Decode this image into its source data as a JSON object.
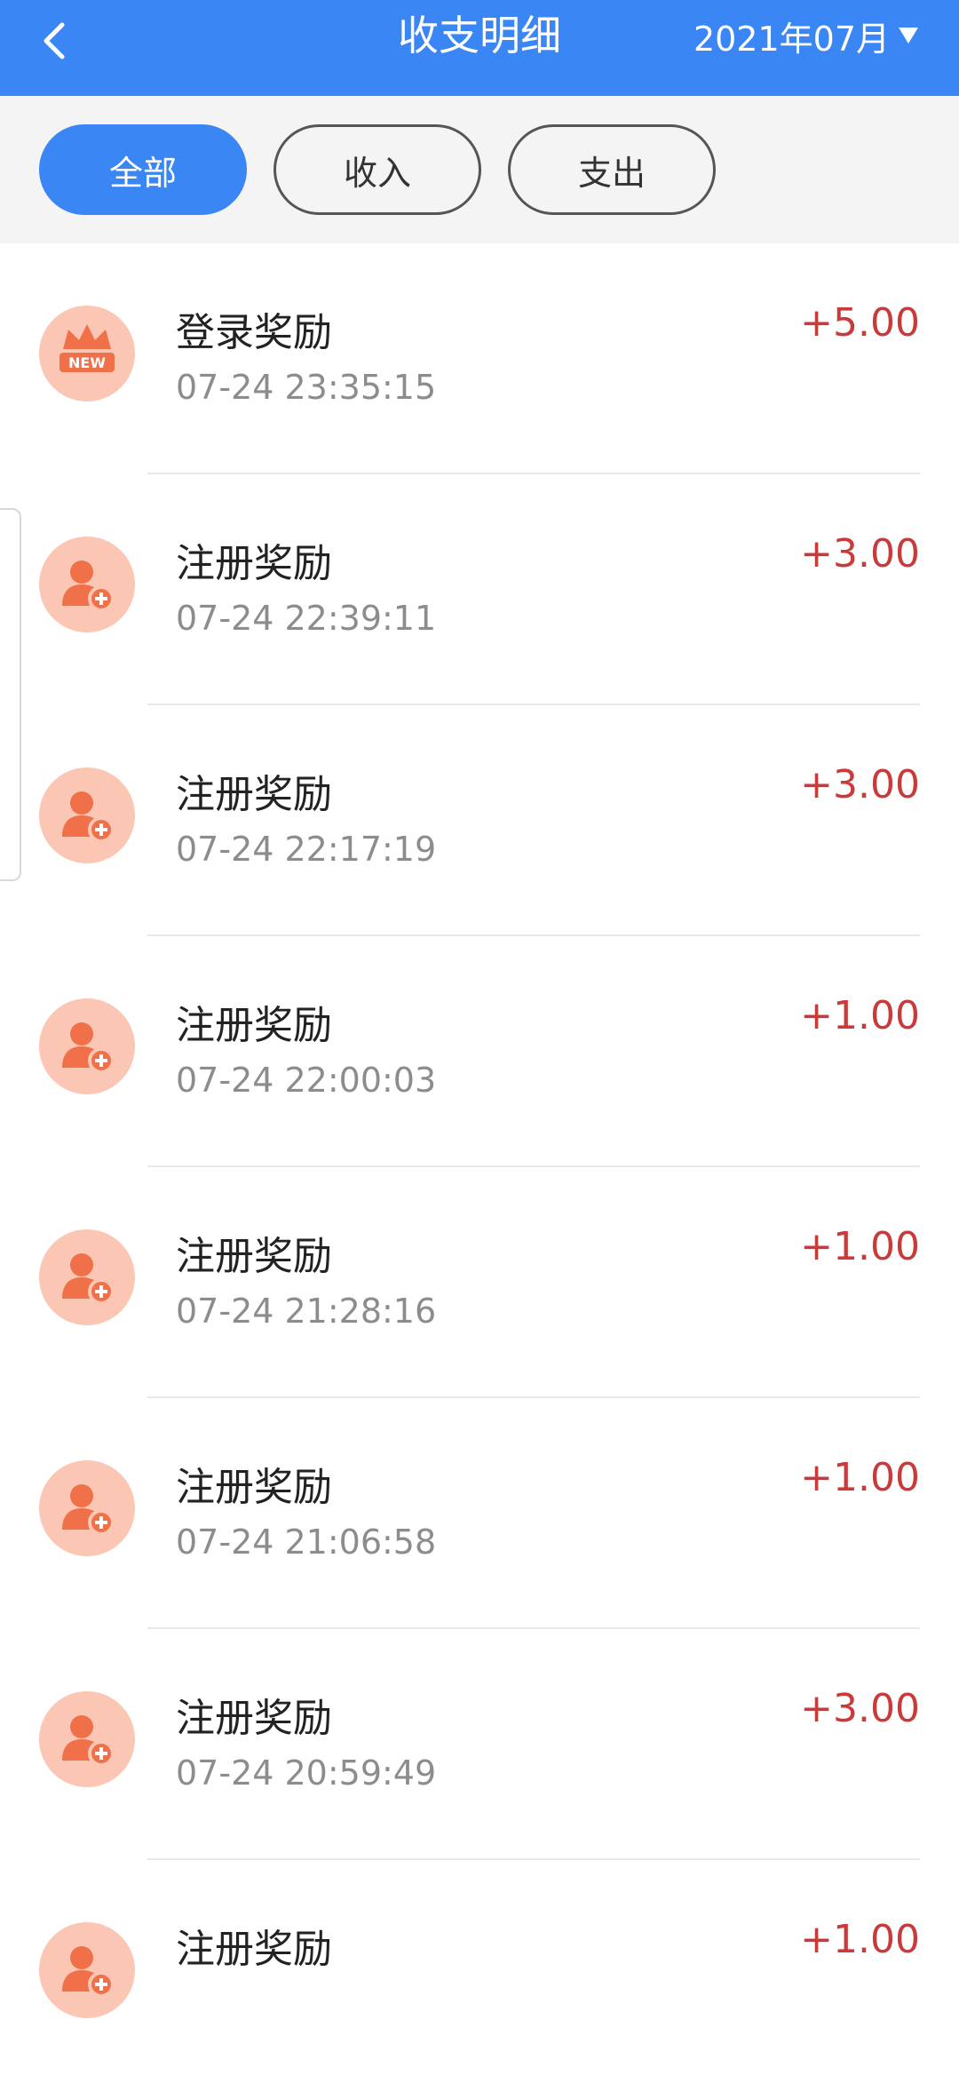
{
  "header": {
    "title": "收支明细",
    "month": "2021年07月"
  },
  "filters": [
    {
      "label": "全部",
      "active": true
    },
    {
      "label": "收入",
      "active": false
    },
    {
      "label": "支出",
      "active": false
    }
  ],
  "records": [
    {
      "title": "登录奖励",
      "time": "07-24 23:35:15",
      "amount": "+5.00",
      "icon": "crown-new-icon"
    },
    {
      "title": "注册奖励",
      "time": "07-24 22:39:11",
      "amount": "+3.00",
      "icon": "add-user-icon"
    },
    {
      "title": "注册奖励",
      "time": "07-24 22:17:19",
      "amount": "+3.00",
      "icon": "add-user-icon"
    },
    {
      "title": "注册奖励",
      "time": "07-24 22:00:03",
      "amount": "+1.00",
      "icon": "add-user-icon"
    },
    {
      "title": "注册奖励",
      "time": "07-24 21:28:16",
      "amount": "+1.00",
      "icon": "add-user-icon"
    },
    {
      "title": "注册奖励",
      "time": "07-24 21:06:58",
      "amount": "+1.00",
      "icon": "add-user-icon"
    },
    {
      "title": "注册奖励",
      "time": "07-24 20:59:49",
      "amount": "+3.00",
      "icon": "add-user-icon"
    },
    {
      "title": "注册奖励",
      "time": "",
      "amount": "+1.00",
      "icon": "add-user-icon"
    }
  ],
  "colors": {
    "brand": "#3a86f4",
    "amount": "#c93a3a",
    "icon_bg": "#fbc7b4",
    "icon_fg": "#f0704a"
  }
}
